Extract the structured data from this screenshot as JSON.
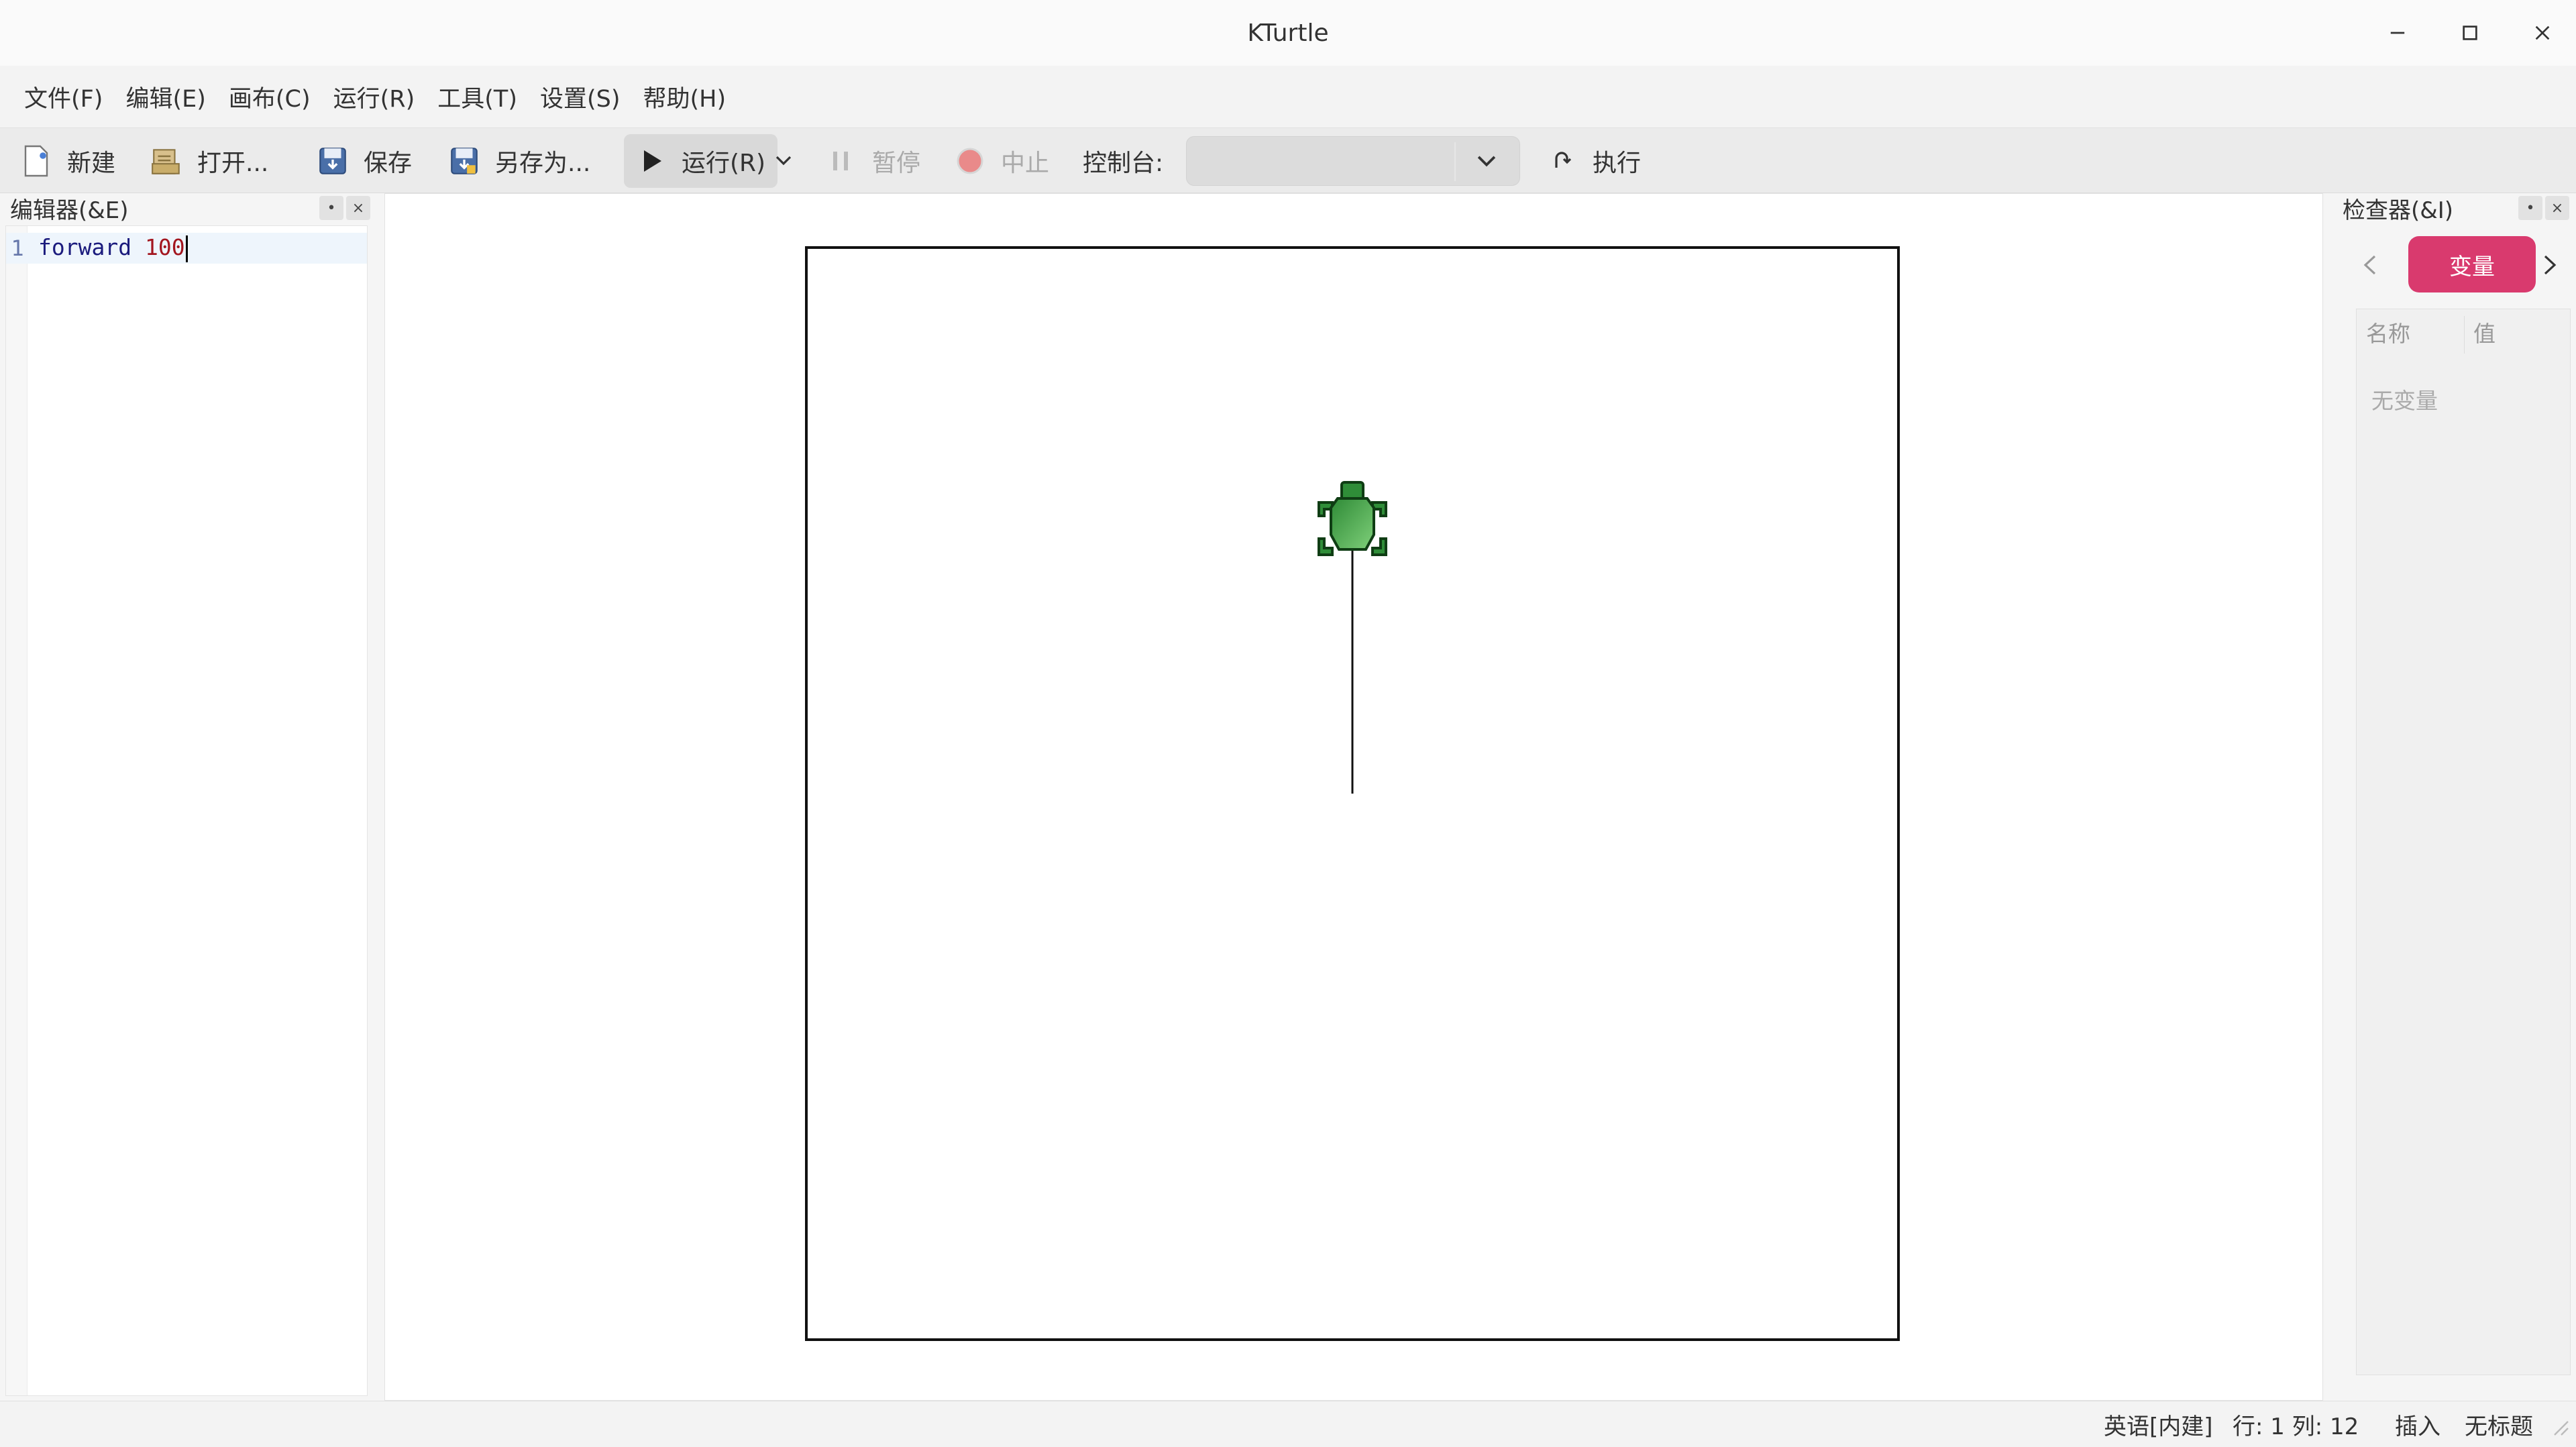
{
  "window": {
    "title": "KTurtle"
  },
  "menu": [
    "文件(F)",
    "编辑(E)",
    "画布(C)",
    "运行(R)",
    "工具(T)",
    "设置(S)",
    "帮助(H)"
  ],
  "toolbar": {
    "new": "新建",
    "open": "打开...",
    "save": "保存",
    "save_as": "另存为...",
    "run": "运行(R)",
    "pause": "暂停",
    "abort": "中止",
    "console_label": "控制台:",
    "console_value": "",
    "execute": "执行"
  },
  "editor": {
    "title": "编辑器(&E)",
    "line_number": "1",
    "code_keyword": "forward",
    "code_number": "100"
  },
  "inspector": {
    "title": "检查器(&I)",
    "active_tab": "变量",
    "col_name": "名称",
    "col_value": "值",
    "empty": "无变量"
  },
  "status": {
    "language": "英语[内建]",
    "position": "行: 1 列: 12",
    "mode": "插入",
    "filename": "无标题"
  },
  "colors": {
    "accent": "#d93a6e",
    "turtle": "#3aa845",
    "keyword": "#1b1b7d",
    "number": "#a3161f"
  },
  "icons": [
    "new-file-icon",
    "open-folder-icon",
    "save-icon",
    "save-as-icon",
    "play-icon",
    "chevron-down-icon",
    "pause-icon",
    "stop-icon",
    "execute-icon",
    "minimize-icon",
    "maximize-icon",
    "close-icon"
  ]
}
